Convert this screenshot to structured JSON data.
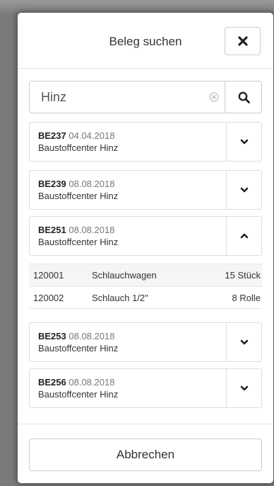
{
  "modal": {
    "title": "Beleg suchen"
  },
  "search": {
    "value": "Hinz"
  },
  "receipts": [
    {
      "id": "BE237",
      "date": "04.04.2018",
      "name": "Baustoffcenter Hinz",
      "expanded": false
    },
    {
      "id": "BE239",
      "date": "08.08.2018",
      "name": "Baustoffcenter Hinz",
      "expanded": false
    },
    {
      "id": "BE251",
      "date": "08.08.2018",
      "name": "Baustoffcenter Hinz",
      "expanded": true
    },
    {
      "id": "BE253",
      "date": "08.08.2018",
      "name": "Baustoffcenter Hinz",
      "expanded": false
    },
    {
      "id": "BE256",
      "date": "08.08.2018",
      "name": "Baustoffcenter Hinz",
      "expanded": false
    }
  ],
  "detail_rows": [
    {
      "article": "120001",
      "description": "Schlauchwagen",
      "quantity": "15 Stück"
    },
    {
      "article": "120002",
      "description": "Schlauch 1/2\"",
      "quantity": "8 Rolle"
    }
  ],
  "footer": {
    "cancel_label": "Abbrechen"
  }
}
